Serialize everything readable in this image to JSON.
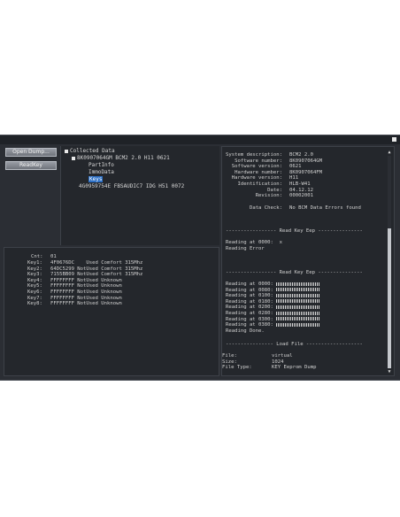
{
  "toolbar": {
    "open_dump": "Open Dump...",
    "read_key": "ReadKey"
  },
  "tree": {
    "root": "Collected Data",
    "device1": "8K0907064GM BCM2 2.0 H11 0621",
    "part_info": "PartInfo",
    "immo_data": "ImmoData",
    "keys": "Keys",
    "device2": "4G0959754E  FBSAUDIC7 IDG H51 0072"
  },
  "keys_info": {
    "cnt": {
      "label": "Cnt:",
      "value": "01"
    },
    "rows": [
      {
        "label": "Key1:",
        "value": "4F0676DC    Used Comfort 315Mhz"
      },
      {
        "label": "Key2:",
        "value": "64DC5299 NotUsed Comfort 315Mhz"
      },
      {
        "label": "Key3:",
        "value": "7155BB09 NotUsed Comfort 315Mhz"
      },
      {
        "label": "Key4:",
        "value": "FFFFFFFF NotUsed Unknown"
      },
      {
        "label": "Key5:",
        "value": "FFFFFFFF NotUsed Unknown"
      },
      {
        "label": "Key6:",
        "value": "FFFFFFFF NotUsed Unknown"
      },
      {
        "label": "Key7:",
        "value": "FFFFFFFF NotUsed Unknown"
      },
      {
        "label": "Key8:",
        "value": "FFFFFFFF NotUsed Unknown"
      }
    ]
  },
  "system": {
    "rows": [
      {
        "label": "System description:",
        "value": "BCM2 2.0"
      },
      {
        "label": "Software number:",
        "value": "8K0907064GM"
      },
      {
        "label": "Software version:",
        "value": "0621"
      },
      {
        "label": "Hardware number:",
        "value": "8K0907064FM"
      },
      {
        "label": "Hardware version:",
        "value": "H11"
      },
      {
        "label": "Identification:",
        "value": "HLB-W41"
      },
      {
        "label": "Date:",
        "value": "04.12.12"
      },
      {
        "label": "Revision:",
        "value": "00002001"
      }
    ],
    "data_check_label": "Data Check:",
    "data_check_value": "No BCM Data Errors found"
  },
  "log": {
    "read_key_eep_header": "----------------- Read Key Eep ---------------",
    "reading_0000_a": "Reading at 0000:  x",
    "reading_error": "Reading Error",
    "read_key_eep_header2": "----------------- Read Key Eep ---------------",
    "reading_lines": [
      "Reading at 0000:",
      "Reading at 0080:",
      "Reading at 0100:",
      "Reading at 0180:",
      "Reading at 0200:",
      "Reading at 0280:",
      "Reading at 0300:",
      "Reading at 0380:"
    ],
    "reading_done": "Reading Done.",
    "load_file_header": "---------------- Load File -------------------",
    "file_rows": [
      {
        "label": "File:",
        "value": "virtual"
      },
      {
        "label": "Size:",
        "value": "1024"
      },
      {
        "label": "File Type:",
        "value": "KEY Eeprom Dump"
      }
    ]
  }
}
